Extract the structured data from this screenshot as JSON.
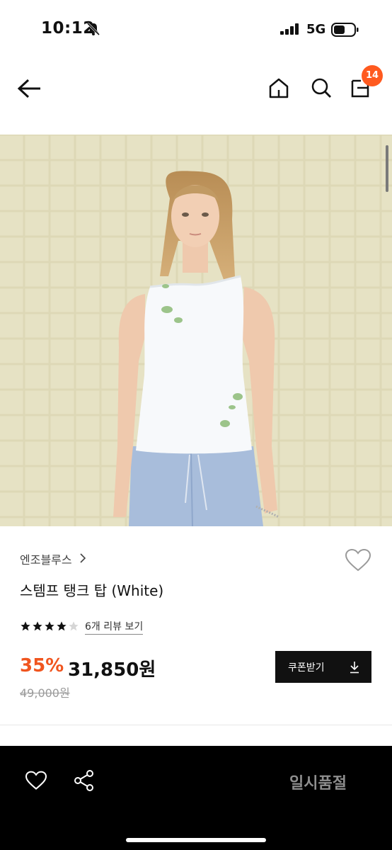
{
  "status_bar": {
    "time": "10:12",
    "network": "5G"
  },
  "header": {
    "cart_count": "14"
  },
  "product": {
    "brand": "엔조블루스",
    "title": "스템프 탱크 탑 (White)",
    "rating": 4,
    "review_link": "6개 리뷰 보기",
    "discount": "35%",
    "price": "31,850원",
    "original_price": "49,000원",
    "coupon_label": "쿠폰받기"
  },
  "bottom_bar": {
    "sold_out_label": "일시품절"
  },
  "colors": {
    "accent": "#f0551f",
    "badge": "#ff5a1f",
    "dark": "#111111"
  }
}
